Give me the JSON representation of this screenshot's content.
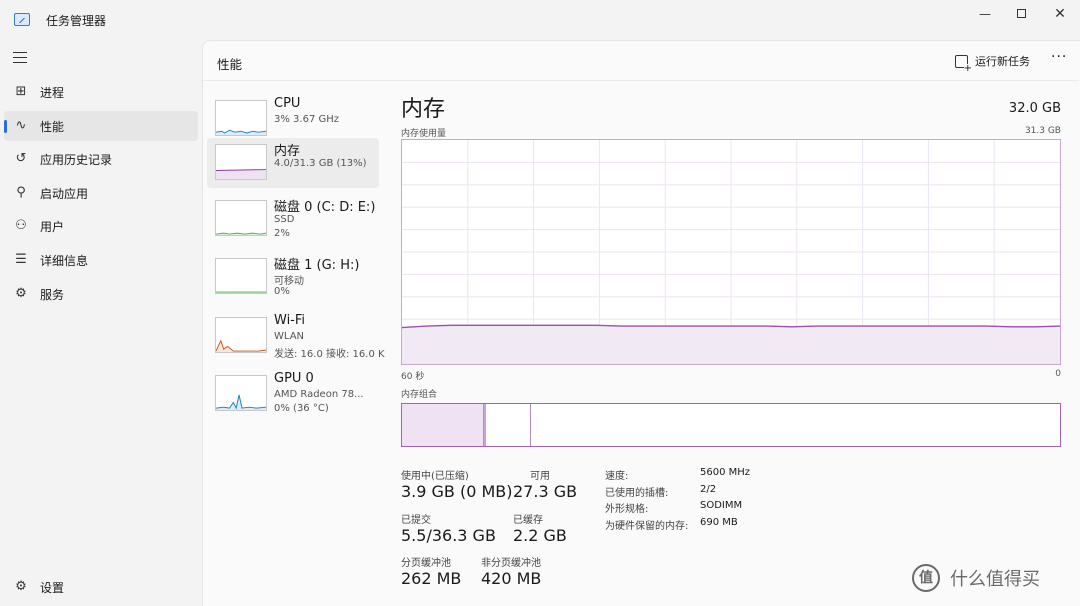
{
  "window": {
    "title": "任务管理器",
    "minimize": "—",
    "close": "✕"
  },
  "nav": {
    "items": [
      {
        "id": "processes",
        "label": "进程",
        "icon": "processes-icon",
        "glyph": "⊞"
      },
      {
        "id": "performance",
        "label": "性能",
        "icon": "performance-icon",
        "glyph": "∿",
        "active": true
      },
      {
        "id": "app-history",
        "label": "应用历史记录",
        "icon": "history-icon",
        "glyph": "↺"
      },
      {
        "id": "startup",
        "label": "启动应用",
        "icon": "startup-icon",
        "glyph": "⚲"
      },
      {
        "id": "users",
        "label": "用户",
        "icon": "users-icon",
        "glyph": "⚇"
      },
      {
        "id": "details",
        "label": "详细信息",
        "icon": "details-icon",
        "glyph": "☰"
      },
      {
        "id": "services",
        "label": "服务",
        "icon": "services-icon",
        "glyph": "⚙"
      }
    ],
    "settings": {
      "label": "设置",
      "icon": "settings-icon",
      "glyph": "⚙"
    }
  },
  "panel": {
    "title": "性能",
    "run_task": "运行新任务",
    "more": "···"
  },
  "devices": [
    {
      "name": "CPU",
      "lines": [
        "3% 3.67 GHz"
      ],
      "color": "#1a82c4"
    },
    {
      "name": "内存",
      "lines": [
        "4.0/31.3 GB (13%)"
      ],
      "color": "#8b3aa8",
      "active": true
    },
    {
      "name": "磁盘 0 (C: D: E:)",
      "lines": [
        "SSD",
        "2%"
      ],
      "color": "#4caf50"
    },
    {
      "name": "磁盘 1 (G: H:)",
      "lines": [
        "可移动",
        "0%"
      ],
      "color": "#4caf50"
    },
    {
      "name": "Wi-Fi",
      "lines": [
        "WLAN",
        "发送: 16.0  接收: 16.0 K"
      ],
      "color": "#c75b1c"
    },
    {
      "name": "GPU 0",
      "lines": [
        "AMD Radeon 78...",
        "0% (36 °C)"
      ],
      "color": "#1a82c4"
    }
  ],
  "detail": {
    "title": "内存",
    "total": "32.0 GB",
    "usage_label": "内存使用量",
    "usage_max": "31.3 GB",
    "axis_left": "60 秒",
    "axis_right": "0",
    "composition_label": "内存组合",
    "line_color": "#9c4fb3",
    "usage_history_gb": [
      5.1,
      5.3,
      5.4,
      5.4,
      5.4,
      5.4,
      5.4,
      5.4,
      5.4,
      5.3,
      5.3,
      5.3,
      5.3,
      5.3,
      5.3,
      5.3,
      5.2,
      5.3,
      5.3,
      5.3,
      5.3,
      5.3,
      5.3,
      5.3,
      5.3,
      5.2,
      5.2,
      5.3
    ],
    "composition": {
      "in_use": 0.125,
      "modified": 0.003,
      "standby": 0.069
    }
  },
  "stats": [
    {
      "label": "使用中(已压缩)",
      "value": "3.9 GB (0 MB)"
    },
    {
      "label": "可用",
      "value": "27.3 GB"
    },
    {
      "label": "已提交",
      "value": "5.5/36.3 GB"
    },
    {
      "label": "已缓存",
      "value": "2.2 GB"
    },
    {
      "label": "分页缓冲池",
      "value": "262 MB"
    },
    {
      "label": "非分页缓冲池",
      "value": "420 MB"
    }
  ],
  "specs": [
    {
      "label": "速度:",
      "value": "5600 MHz"
    },
    {
      "label": "已使用的插槽:",
      "value": "2/2"
    },
    {
      "label": "外形规格:",
      "value": "SODIMM"
    },
    {
      "label": "为硬件保留的内存:",
      "value": "690 MB"
    }
  ],
  "watermark": {
    "logo": "值",
    "text": "什么值得买"
  }
}
